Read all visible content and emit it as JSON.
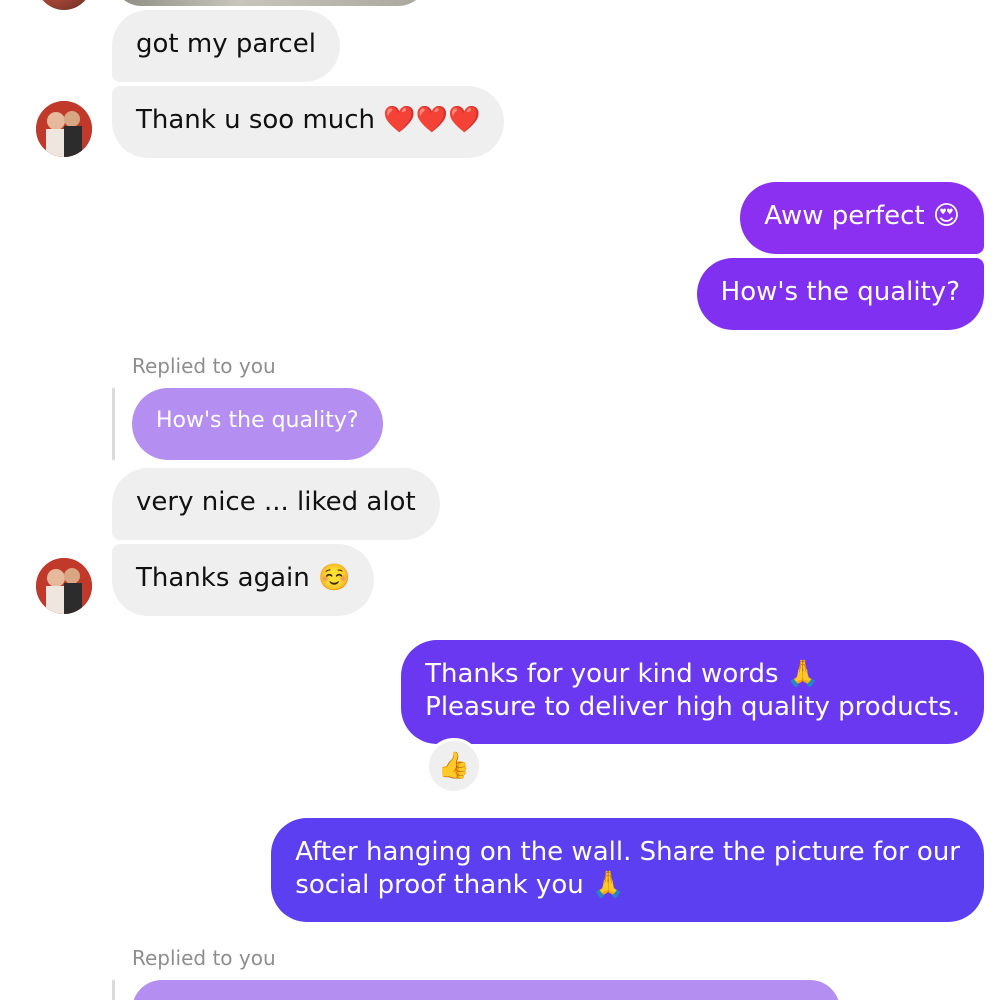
{
  "messages": [
    {
      "id": "m1",
      "direction": "incoming",
      "text": "got my parcel"
    },
    {
      "id": "m2",
      "direction": "incoming",
      "text": "Thank u soo much ❤️❤️❤️"
    },
    {
      "id": "m3",
      "direction": "outgoing",
      "text": "Aww perfect 😍"
    },
    {
      "id": "m4",
      "direction": "outgoing",
      "text": "How's the quality?"
    },
    {
      "id": "m5",
      "direction": "incoming",
      "reply_label": "Replied to you",
      "quoted_text": "How's the quality?"
    },
    {
      "id": "m6",
      "direction": "incoming",
      "text": "very nice ... liked alot"
    },
    {
      "id": "m7",
      "direction": "incoming",
      "text": "Thanks again ☺️"
    },
    {
      "id": "m8",
      "direction": "outgoing",
      "line1": "Thanks for your kind words 🙏",
      "line2": "Pleasure to deliver high quality products.",
      "reaction": "👍"
    },
    {
      "id": "m9",
      "direction": "outgoing",
      "line1": "After hanging on the wall. Share the picture for our",
      "line2": "social proof thank you 🙏"
    },
    {
      "id": "m10",
      "direction": "incoming",
      "reply_label": "Replied to you"
    }
  ],
  "colors": {
    "incoming_bubble": "#efefef",
    "outgoing_top": "#8b2ff0",
    "outgoing_mid": "#7433f0",
    "outgoing_bottom": "#5b3ff0",
    "quoted_bubble": "#b48ef0",
    "label_gray": "#8e8e8e"
  }
}
